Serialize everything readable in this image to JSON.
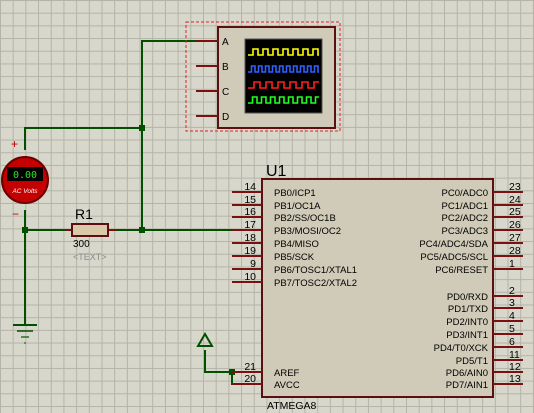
{
  "schematic": {
    "mcu": {
      "ref": "U1",
      "part": "ATMEGA8",
      "left_pins": [
        {
          "num": "14",
          "label": "PB0/ICP1"
        },
        {
          "num": "15",
          "label": "PB1/OC1A"
        },
        {
          "num": "16",
          "label": "PB2/SS/OC1B"
        },
        {
          "num": "17",
          "label": "PB3/MOSI/OC2"
        },
        {
          "num": "18",
          "label": "PB4/MISO"
        },
        {
          "num": "19",
          "label": "PB5/SCK"
        },
        {
          "num": "9",
          "label": "PB6/TOSC1/XTAL1"
        },
        {
          "num": "10",
          "label": "PB7/TOSC2/XTAL2"
        },
        {
          "num": "21",
          "label": "AREF"
        },
        {
          "num": "20",
          "label": "AVCC"
        }
      ],
      "right_pins": [
        {
          "num": "23",
          "label": "PC0/ADC0"
        },
        {
          "num": "24",
          "label": "PC1/ADC1"
        },
        {
          "num": "25",
          "label": "PC2/ADC2"
        },
        {
          "num": "26",
          "label": "PC3/ADC3"
        },
        {
          "num": "27",
          "label": "PC4/ADC4/SDA"
        },
        {
          "num": "28",
          "label": "PC5/ADC5/SCL"
        },
        {
          "num": "1",
          "label": "PC6/RESET"
        },
        {
          "num": "2",
          "label": "PD0/RXD"
        },
        {
          "num": "3",
          "label": "PD1/TXD"
        },
        {
          "num": "4",
          "label": "PD2/INT0"
        },
        {
          "num": "5",
          "label": "PD3/INT1"
        },
        {
          "num": "6",
          "label": "PD4/T0/XCK"
        },
        {
          "num": "11",
          "label": "PD5/T1"
        },
        {
          "num": "12",
          "label": "PD6/AIN0"
        },
        {
          "num": "13",
          "label": "PD7/AIN1"
        }
      ]
    },
    "resistor": {
      "ref": "R1",
      "value": "300",
      "text": "<TEXT>"
    },
    "voltmeter": {
      "label": "AC Volts",
      "display": "0.00"
    },
    "oscilloscope": {
      "channels": [
        "A",
        "B",
        "C",
        "D"
      ],
      "trace_colors": [
        "#ffff00",
        "#3060ff",
        "#ff2020",
        "#20ff20"
      ]
    },
    "colors": {
      "wire": "#005000",
      "body_fill": "#cfcbb8",
      "body_stroke": "#5a1010",
      "pin": "#7a1010"
    }
  }
}
